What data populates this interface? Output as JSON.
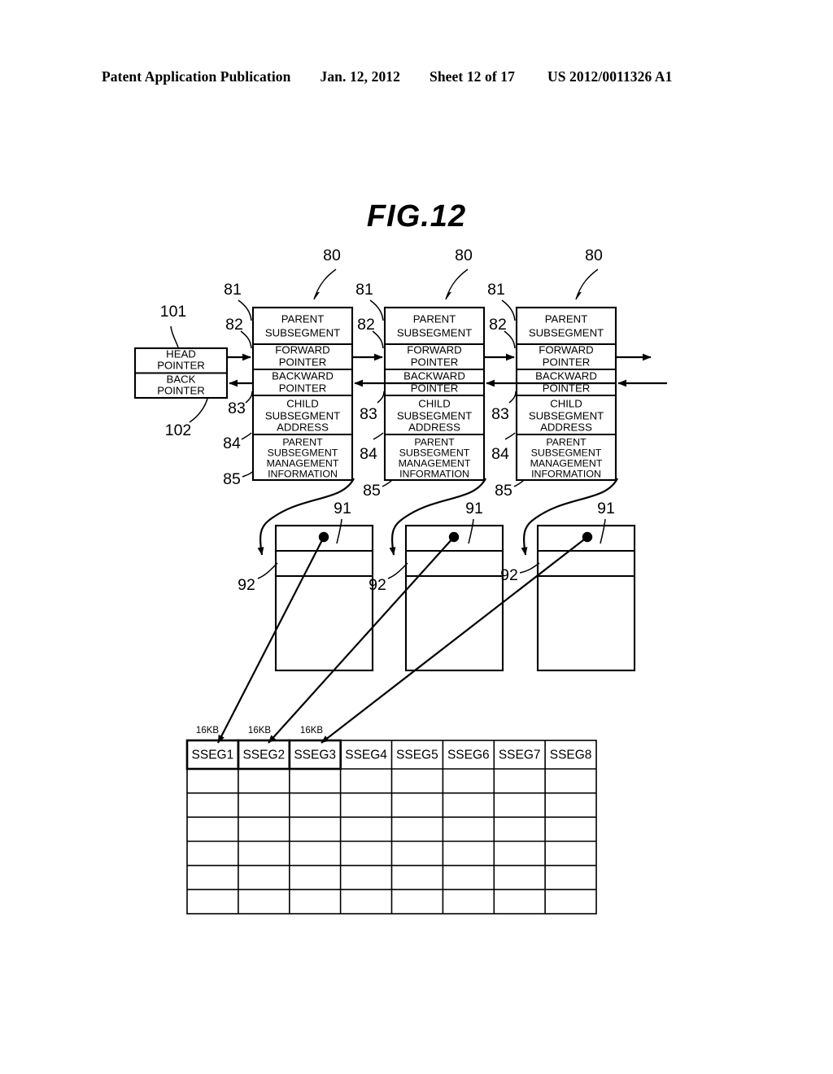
{
  "header": {
    "publication": "Patent Application Publication",
    "date": "Jan. 12, 2012",
    "sheet": "Sheet 12 of 17",
    "docnum": "US 2012/0011326 A1"
  },
  "figure": {
    "title": "FIG.12"
  },
  "head_pointer_box": {
    "ref_top": "101",
    "ref_bottom": "102",
    "rows": [
      {
        "line1": "HEAD",
        "line2": "POINTER"
      },
      {
        "line1": "BACK",
        "line2": "POINTER"
      }
    ]
  },
  "parent_nodes": {
    "ref_node": "80",
    "refs": {
      "parent_subsegment": "81",
      "forward_pointer": "82",
      "backward_pointer": "83",
      "child_subsegment_address": "84",
      "parent_subsegment_management_information": "85"
    },
    "rows": [
      {
        "lines": [
          "PARENT",
          "SUBSEGMENT"
        ]
      },
      {
        "lines": [
          "FORWARD",
          "POINTER"
        ]
      },
      {
        "lines": [
          "BACKWARD",
          "POINTER"
        ]
      },
      {
        "lines": [
          "CHILD",
          "SUBSEGMENT",
          "ADDRESS"
        ]
      },
      {
        "lines": [
          "PARENT",
          "SUBSEGMENT",
          "MANAGEMENT",
          "INFORMATION"
        ]
      }
    ],
    "instances": [
      {
        "index": 1
      },
      {
        "index": 2
      },
      {
        "index": 3
      }
    ]
  },
  "child_blocks": {
    "ref_block": "91",
    "ref_row": "92",
    "instances": [
      {
        "index": 1
      },
      {
        "index": 2
      },
      {
        "index": 3
      }
    ]
  },
  "segment_table": {
    "size_labels": [
      "16KB",
      "16KB",
      "16KB"
    ],
    "columns": [
      "SSEG1",
      "SSEG2",
      "SSEG3",
      "SSEG4",
      "SSEG5",
      "SSEG6",
      "SSEG7",
      "SSEG8"
    ],
    "body_row_count": 6,
    "highlighted_columns": [
      "SSEG1",
      "SSEG2",
      "SSEG3"
    ]
  },
  "colors": {
    "line": "#000000",
    "background": "#ffffff"
  }
}
